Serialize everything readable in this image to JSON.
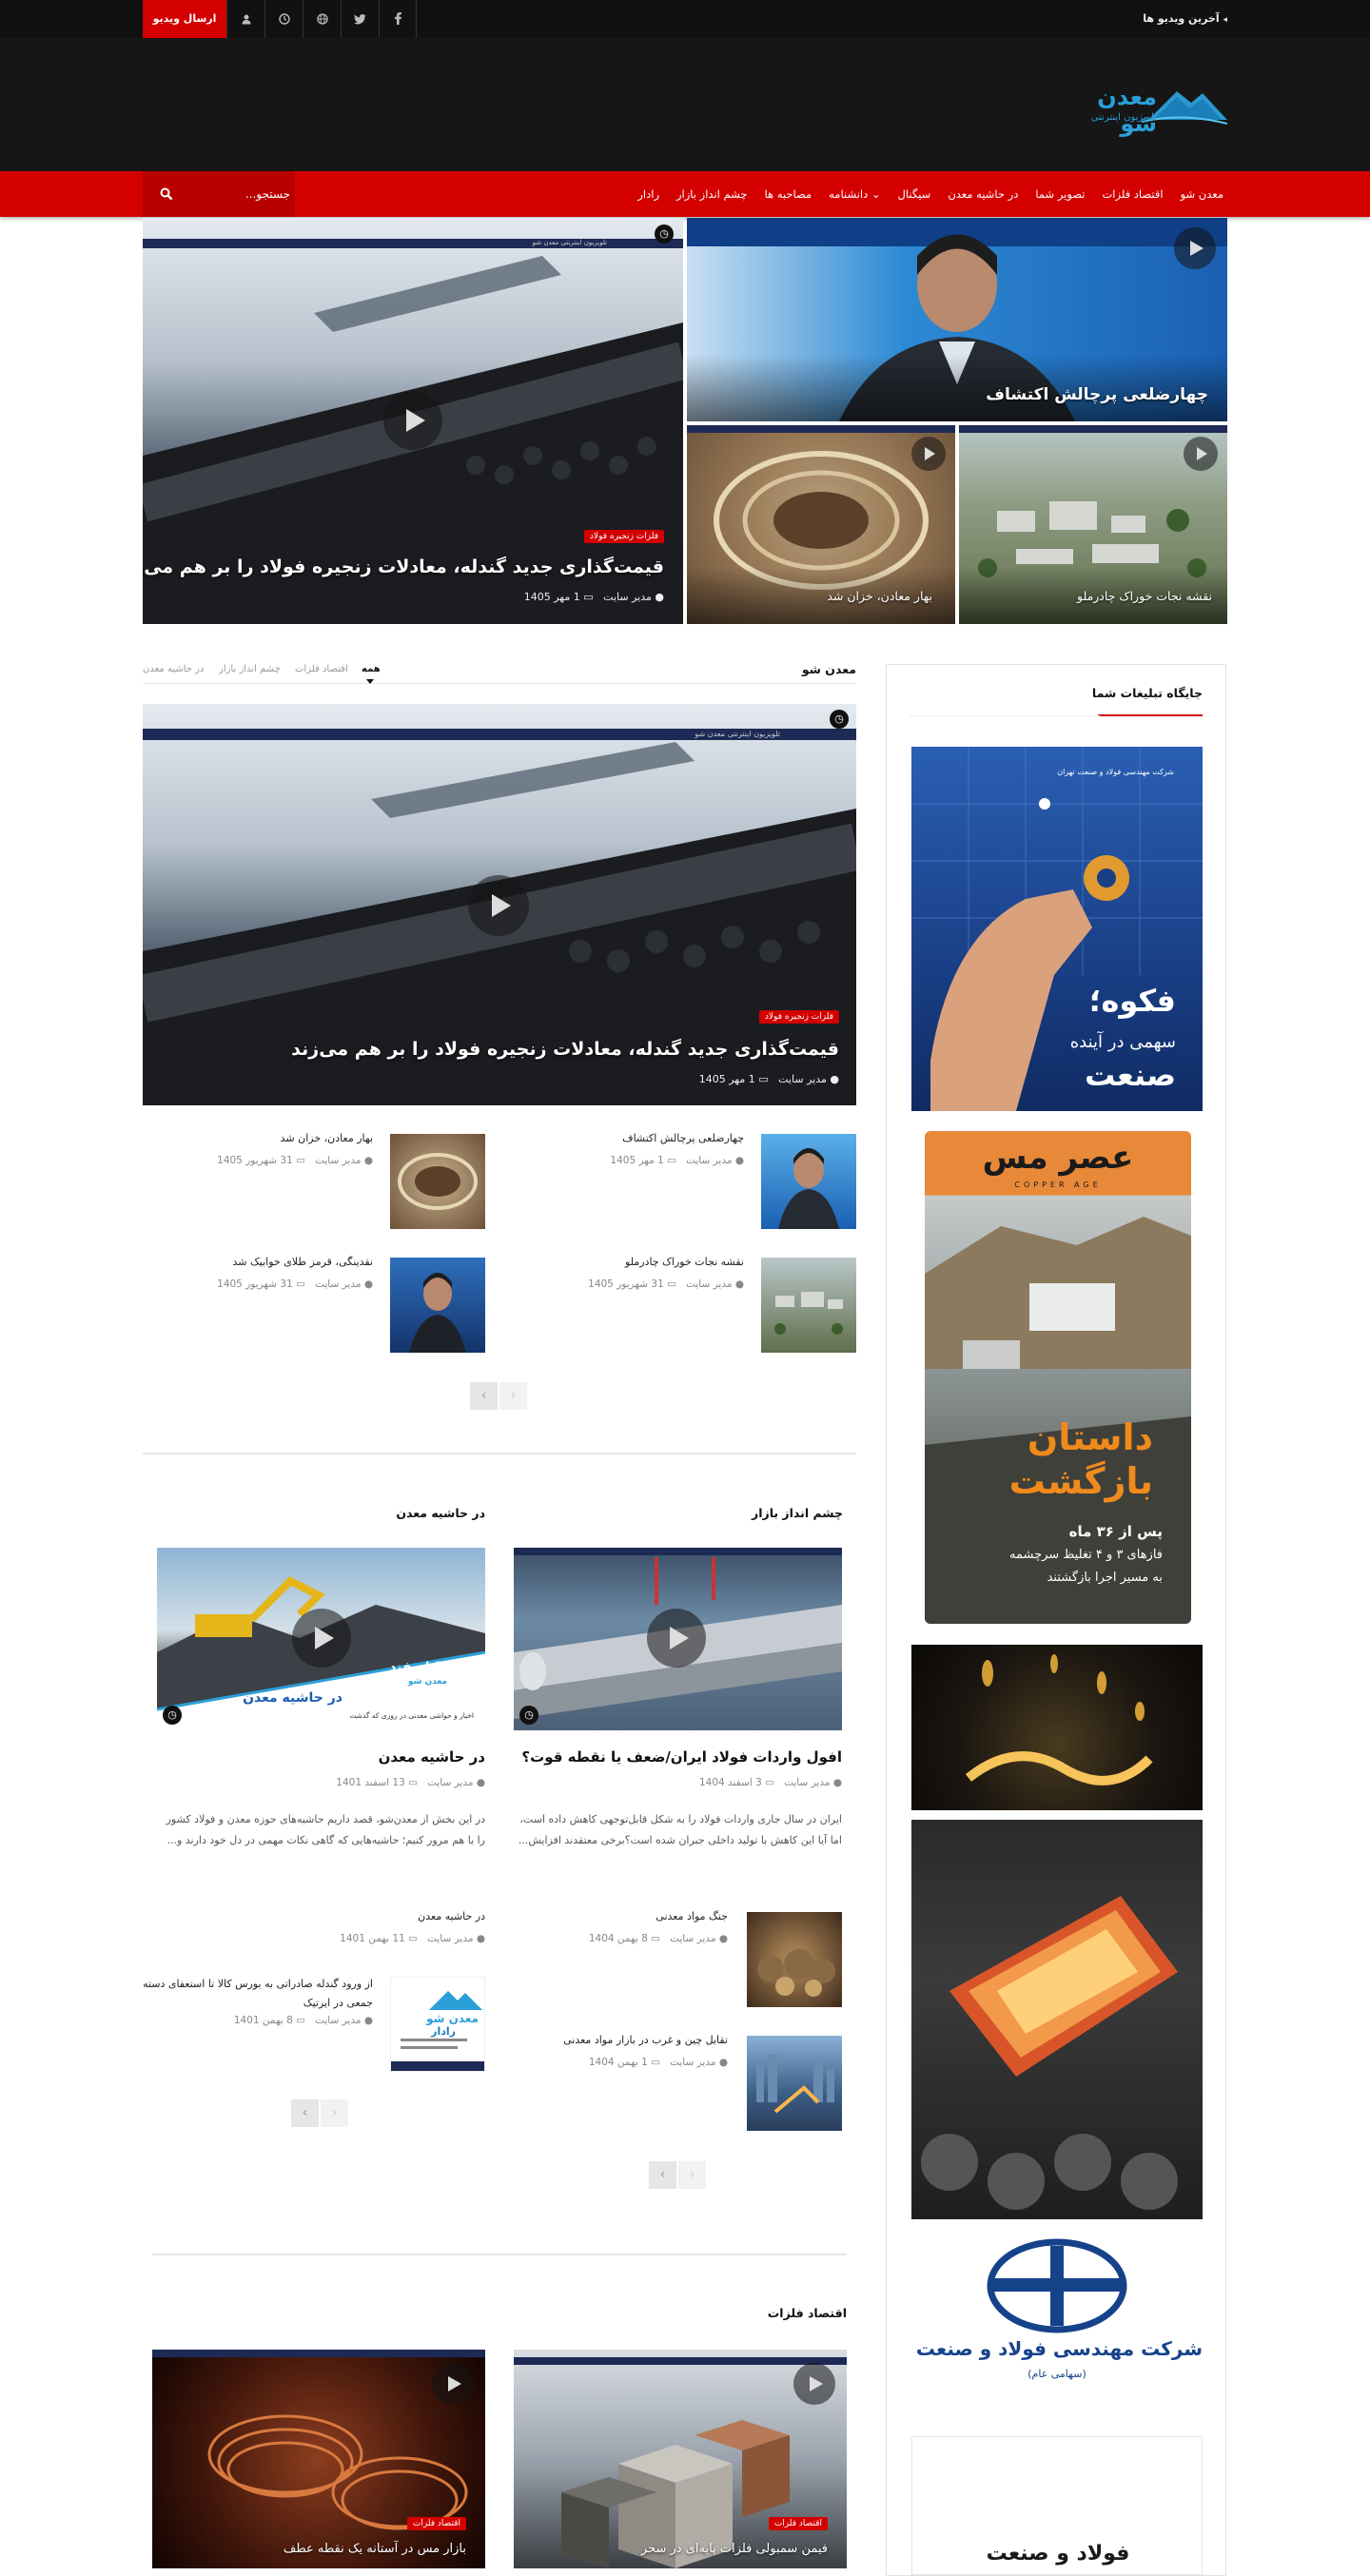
{
  "topbar": {
    "submit_video": "ارسال ویدیو",
    "latest_videos": "آخرین ویدیو ها",
    "latest_arrow": "◂",
    "icons": [
      "user-icon",
      "clock-icon",
      "globe-icon",
      "twitter-icon",
      "facebook-icon"
    ]
  },
  "brand": {
    "logo_title": "معدن شو",
    "logo_subtitle": "تلویزیون اینترنتی",
    "colors": {
      "accent": "#d40000",
      "header": "#161616",
      "topbar": "#111111",
      "logo": "#2a9fd8"
    }
  },
  "nav": {
    "items": [
      "معدن شو",
      "اقتصاد فلزات",
      "تصویر شما",
      "در حاشیه معدن",
      "سیگنال",
      "دانشنامه",
      "مصاحبه ها",
      "چشم انداز بازار",
      "رادار"
    ],
    "dropdown_marker": "⌄",
    "search_placeholder": "جستجو..."
  },
  "hero": {
    "main": {
      "category": "فلزات زنجیره فولاد",
      "title": "قیمت‌گذاری جدید گندله، معادلات زنجیره فولاد را بر هم می‌زند",
      "author": "مدیر سایت",
      "date": "1 مهر 1405",
      "strip": "تلویزیون اینترنتی معدن شو"
    },
    "top_right": {
      "title": "چهارضلعی پرچالش اکتشاف"
    },
    "bottom_left": {
      "title": "بهار معادن، خزان شد"
    },
    "bottom_right": {
      "title": "نقشه نجات خوراک چادرملو"
    }
  },
  "section_main": {
    "title": "معدن شو",
    "tabs": [
      "همه",
      "اقتصاد فلزات",
      "چشم انداز بازار",
      "در حاشیه معدن"
    ],
    "feature": {
      "category": "فلزات زنجیره فولاد",
      "title": "قیمت‌گذاری جدید گندله، معادلات زنجیره فولاد را بر هم می‌زند",
      "author": "مدیر سایت",
      "date": "1 مهر 1405",
      "strip": "تلویزیون اینترنتی معدن شو"
    },
    "list": [
      {
        "title": "چهارضلعی پرچالش اکتشاف",
        "author": "مدیر سایت",
        "date": "1 مهر 1405"
      },
      {
        "title": "بهار معادن، خزان شد",
        "author": "مدیر سایت",
        "date": "31 شهریور 1405"
      },
      {
        "title": "نقشه نجات خوراک چادرملو",
        "author": "مدیر سایت",
        "date": "31 شهریور 1405"
      },
      {
        "title": "نقدینگی، قرمز طلای خوابیک شد",
        "author": "مدیر سایت",
        "date": "31 شهریور 1405"
      }
    ],
    "pager": {
      "prev": "‹",
      "next": "›"
    }
  },
  "section_market": {
    "title": "چشم انداز بازار",
    "feature": {
      "title": "افول واردات فولاد ایران/ضعف یا نقطه قوت؟",
      "author": "مدیر سایت",
      "date": "3 اسفند 1404",
      "excerpt": "ایران در سال جاری واردات فولاد را به شکل قابل‌توجهی کاهش داده است، اما آیا این کاهش با تولید داخلی جبران شده است؟برخی معتقدند افزایش..."
    },
    "list": [
      {
        "title": "جنگ مواد معدنی",
        "author": "مدیر سایت",
        "date": "8 بهمن 1404"
      },
      {
        "title": "تقابل چین و غرب در بازار مواد معدنی",
        "author": "مدیر سایت",
        "date": "1 بهمن 1404"
      }
    ]
  },
  "section_margin": {
    "title": "در حاشیه معدن",
    "feature": {
      "title": "در حاشیه معدن",
      "author": "مدیر سایت",
      "date": "13 اسفند 1401",
      "excerpt": "در این بخش از معدن‌شو، قصد داریم حاشیه‌های حوزه معدن و فولاد کشور را با هم مرور کنیم؛ حاشیه‌هایی که گاهی نکات مهمی در دل خود دارند و...",
      "poster_day": "11 اسفند",
      "poster_heading": "در حاشیه معدن",
      "poster_sub": "اخبار و حواشی معدنی در روزی که گذشت",
      "poster_logo": "معدن شو"
    },
    "list": [
      {
        "title": "در حاشیه معدن",
        "author": "مدیر سایت",
        "date": "11 بهمن 1401"
      },
      {
        "title": "از ورود گندله صادراتی به بورس کالا تا استعفای دسته جمعی در ایرتیک",
        "author": "مدیر سایت",
        "date": "8 بهمن 1401",
        "thumb_label": "رادار"
      }
    ]
  },
  "section_metals": {
    "title": "اقتصاد فلزات",
    "items": [
      {
        "category": "اقتصاد فلزات",
        "title": "فیمن سمبولی فلزات پایه‌ای در سحر"
      },
      {
        "category": "اقتصاد فلزات",
        "title": "بازار مس در آستانه یک نقطه عطف"
      }
    ]
  },
  "sidebar": {
    "title": "جایگاه تبلیغات شما",
    "ad1": {
      "company": "شرکت مهندسی فولاد و صنعت تهران",
      "line1": "فکوه؛",
      "line2": "سهمی در آینده",
      "line3": "صنعت"
    },
    "ad2": {
      "mag_title": "عصر مس",
      "mag_sub": "COPPER AGE",
      "headline1": "داستان",
      "headline2": "بازگشت",
      "sub1": "پس از ۳۶ ماه",
      "sub2": "فازهای ۳ و ۴ تغلیظ سرچشمه",
      "sub3": "به مسیر اجرا بازگشتند"
    },
    "ad4": {
      "company": "شرکت مهندسی فولاد و صنعت تهران",
      "company_sub": "(سهامی عام)"
    },
    "ad5": {
      "text": "فولاد و صنعت"
    }
  }
}
